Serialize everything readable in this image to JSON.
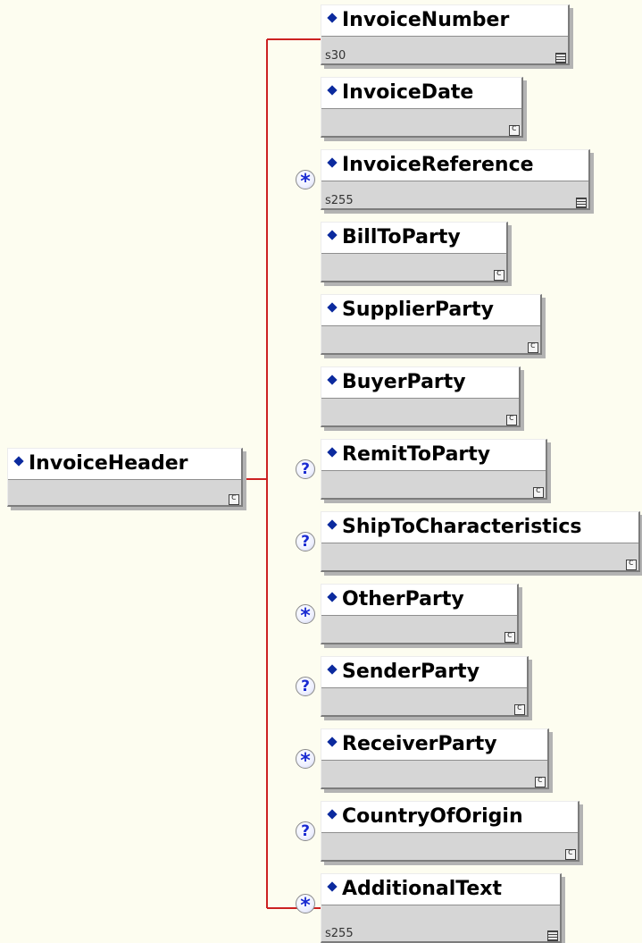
{
  "root": {
    "name": "InvoiceHeader",
    "type_icon": "complex-type-icon"
  },
  "children": [
    {
      "name": "InvoiceNumber",
      "facet": "s30",
      "occurrence": "",
      "type_icon": "simple-type-icon"
    },
    {
      "name": "InvoiceDate",
      "facet": "",
      "occurrence": "",
      "type_icon": "complex-type-icon"
    },
    {
      "name": "InvoiceReference",
      "facet": "s255",
      "occurrence": "*",
      "type_icon": "simple-type-icon"
    },
    {
      "name": "BillToParty",
      "facet": "",
      "occurrence": "",
      "type_icon": "complex-type-icon"
    },
    {
      "name": "SupplierParty",
      "facet": "",
      "occurrence": "",
      "type_icon": "complex-type-icon"
    },
    {
      "name": "BuyerParty",
      "facet": "",
      "occurrence": "",
      "type_icon": "complex-type-icon"
    },
    {
      "name": "RemitToParty",
      "facet": "",
      "occurrence": "?",
      "type_icon": "complex-type-icon"
    },
    {
      "name": "ShipToCharacteristics",
      "facet": "",
      "occurrence": "?",
      "type_icon": "complex-type-icon"
    },
    {
      "name": "OtherParty",
      "facet": "",
      "occurrence": "*",
      "type_icon": "complex-type-icon"
    },
    {
      "name": "SenderParty",
      "facet": "",
      "occurrence": "?",
      "type_icon": "complex-type-icon"
    },
    {
      "name": "ReceiverParty",
      "facet": "",
      "occurrence": "*",
      "type_icon": "complex-type-icon"
    },
    {
      "name": "CountryOfOrigin",
      "facet": "",
      "occurrence": "?",
      "type_icon": "complex-type-icon"
    },
    {
      "name": "AdditionalText",
      "facet": "s255",
      "occurrence": "*",
      "type_icon": "simple-type-icon"
    }
  ],
  "colors": {
    "connector": "#cc2222",
    "diamond": "#0b2a9e",
    "box_fill": "#d6d6d6",
    "background": "#fdfdf0",
    "occurrence_text": "#1a2bd2"
  }
}
